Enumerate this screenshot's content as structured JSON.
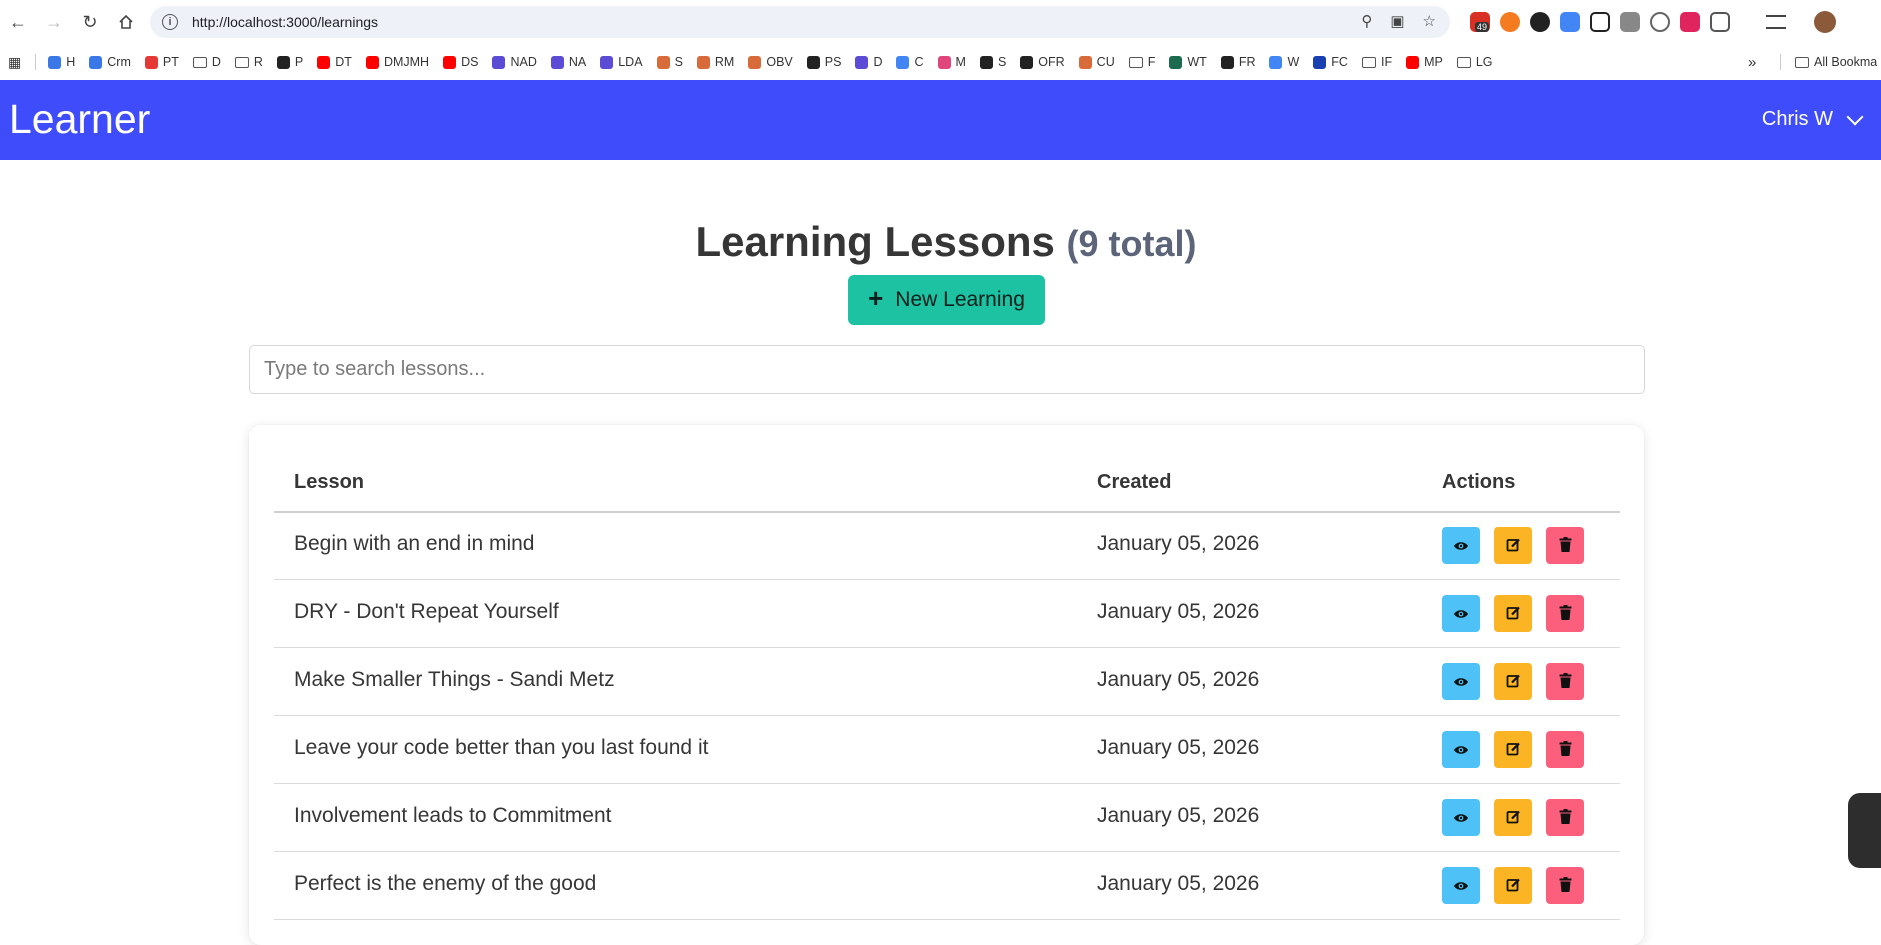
{
  "browser": {
    "url": "http://localhost:3000/learnings",
    "badge_count": "49",
    "bookmarks": [
      {
        "label": "H",
        "color": "#3b78e7"
      },
      {
        "label": "Crm",
        "color": "#3b78e7"
      },
      {
        "label": "PT",
        "color": "#e53935"
      },
      {
        "label": "D",
        "color": "folder"
      },
      {
        "label": "R",
        "color": "folder"
      },
      {
        "label": "P",
        "color": "#222222"
      },
      {
        "label": "DT",
        "color": "#ff0000"
      },
      {
        "label": "DMJMH",
        "color": "#ff0000"
      },
      {
        "label": "DS",
        "color": "#ff0000"
      },
      {
        "label": "NAD",
        "color": "#5b4bd5"
      },
      {
        "label": "NA",
        "color": "#5b4bd5"
      },
      {
        "label": "LDA",
        "color": "#5b4bd5"
      },
      {
        "label": "S",
        "color": "#d96b3b"
      },
      {
        "label": "RM",
        "color": "#d96b3b"
      },
      {
        "label": "OBV",
        "color": "#d96b3b"
      },
      {
        "label": "PS",
        "color": "#222222"
      },
      {
        "label": "D",
        "color": "#5b4bd5"
      },
      {
        "label": "C",
        "color": "#4285f4"
      },
      {
        "label": "M",
        "color": "#e0457b"
      },
      {
        "label": "S",
        "color": "#222222"
      },
      {
        "label": "OFR",
        "color": "#222222"
      },
      {
        "label": "CU",
        "color": "#d96b3b"
      },
      {
        "label": "F",
        "color": "folder"
      },
      {
        "label": "WT",
        "color": "#1d6b4f"
      },
      {
        "label": "FR",
        "color": "#222222"
      },
      {
        "label": "W",
        "color": "#4285f4"
      },
      {
        "label": "FC",
        "color": "#1a3fb0"
      },
      {
        "label": "IF",
        "color": "folder"
      },
      {
        "label": "MP",
        "color": "#ff0000"
      },
      {
        "label": "LG",
        "color": "folder"
      }
    ],
    "all_bookmarks": "All Bookma"
  },
  "header": {
    "brand": "Learner",
    "user": "Chris W",
    "color": "#3f4cfb"
  },
  "page": {
    "title": "Learning Lessons",
    "count": "(9 total)",
    "new_button": "New Learning",
    "search_placeholder": "Type to search lessons...",
    "accent": "#1cc2a2"
  },
  "table": {
    "headers": {
      "lesson": "Lesson",
      "created": "Created",
      "actions": "Actions"
    },
    "rows": [
      {
        "lesson": "Begin with an end in mind",
        "created": "January 05, 2026"
      },
      {
        "lesson": "DRY - Don't Repeat Yourself",
        "created": "January 05, 2026"
      },
      {
        "lesson": "Make Smaller Things - Sandi Metz",
        "created": "January 05, 2026"
      },
      {
        "lesson": "Leave your code better than you last found it",
        "created": "January 05, 2026"
      },
      {
        "lesson": "Involvement leads to Commitment",
        "created": "January 05, 2026"
      },
      {
        "lesson": "Perfect is the enemy of the good",
        "created": "January 05, 2026"
      }
    ],
    "action_colors": {
      "view": "#4ec2f7",
      "edit": "#fbb423",
      "delete": "#fb5f7c"
    }
  }
}
